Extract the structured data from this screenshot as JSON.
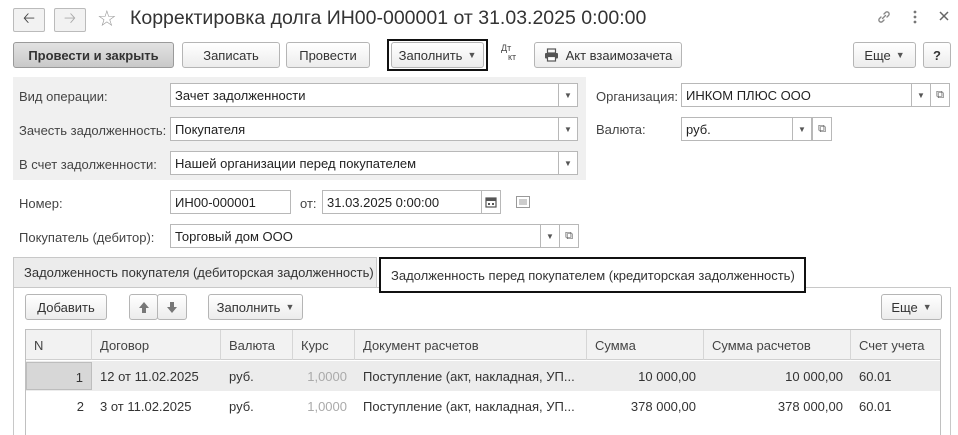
{
  "window": {
    "title": "Корректировка долга ИН00-000001 от 31.03.2025 0:00:00",
    "back_icon": "arrow-left",
    "forward_icon": "arrow-right",
    "favorite_icon": "star",
    "link_icon": "link",
    "more_icon": "vertical-dots",
    "close_icon": "close"
  },
  "toolbar": {
    "post_close": "Провести и закрыть",
    "save": "Записать",
    "post": "Провести",
    "fill": "Заполнить",
    "dtkt_top": "Дт",
    "dtkt_bottom": "кт",
    "netting_act": "Акт взаимозачета",
    "more": "Еще",
    "help": "?"
  },
  "form": {
    "operation_label": "Вид операции:",
    "operation_value": "Зачет задолженности",
    "offset_label": "Зачесть задолженность:",
    "offset_value": "Покупателя",
    "against_label": "В счет задолженности:",
    "against_value": "Нашей организации перед покупателем",
    "org_label": "Организация:",
    "org_value": "ИНКОМ ПЛЮС ООО",
    "currency_label": "Валюта:",
    "currency_value": "руб.",
    "number_label": "Номер:",
    "number_value": "ИН00-000001",
    "date_label": "от:",
    "date_value": "31.03.2025  0:00:00",
    "buyer_label": "Покупатель (дебитор):",
    "buyer_value": "Торговый дом ООО"
  },
  "tabs": [
    {
      "label": "Задолженность покупателя (дебиторская задолженность)",
      "active": false
    },
    {
      "label": "Задолженность перед покупателем (кредиторская задолженность)",
      "active": true
    }
  ],
  "table_toolbar": {
    "add": "Добавить",
    "fill": "Заполнить",
    "more": "Еще"
  },
  "table": {
    "columns": [
      "N",
      "Договор",
      "Валюта",
      "Курс",
      "Документ расчетов",
      "Сумма",
      "Сумма расчетов",
      "Счет учета"
    ],
    "rows": [
      [
        "1",
        "12 от 11.02.2025",
        "руб.",
        "1,0000",
        "Поступление (акт, накладная, УП...",
        "10 000,00",
        "10 000,00",
        "60.01"
      ],
      [
        "2",
        "3 от 11.02.2025",
        "руб.",
        "1,0000",
        "Поступление (акт, накладная, УП...",
        "378 000,00",
        "378 000,00",
        "60.01"
      ]
    ]
  }
}
